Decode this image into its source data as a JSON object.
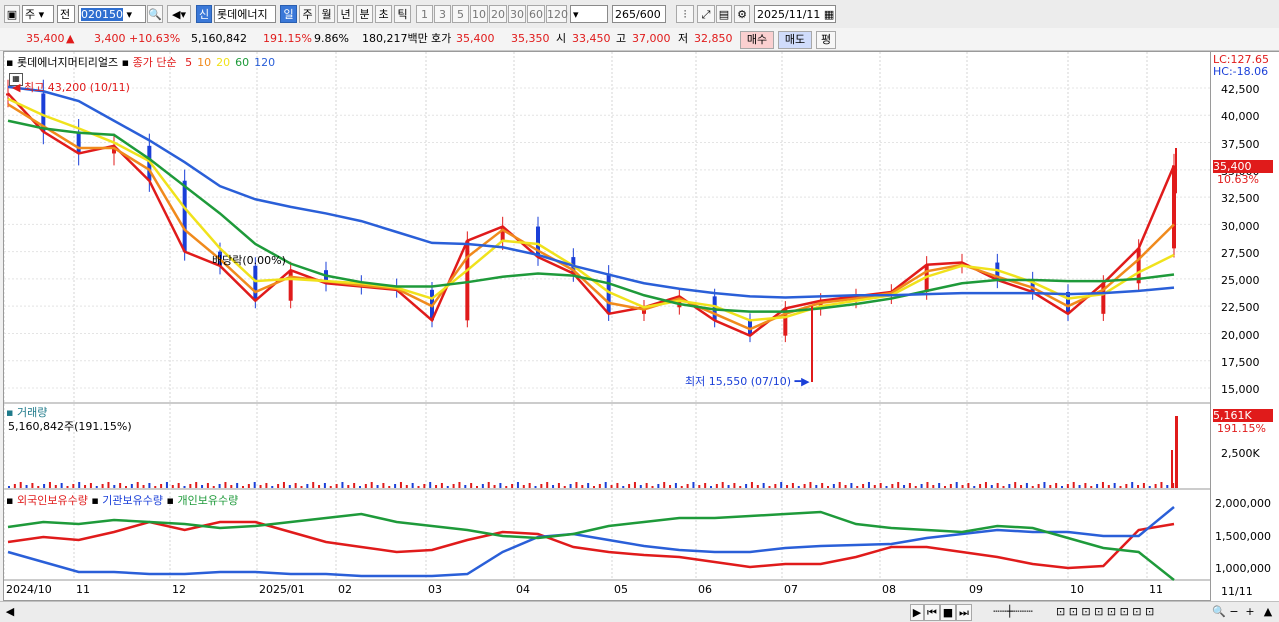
{
  "toolbar": {
    "mode1": "주",
    "mode2": "전",
    "code": "020150",
    "sin": "신",
    "stock_name": "롯데에너지",
    "periods": [
      "일",
      "주",
      "월",
      "년",
      "분",
      "초",
      "틱"
    ],
    "active_period": "일",
    "nums": [
      "1",
      "3",
      "5",
      "10",
      "20",
      "30",
      "60",
      "120"
    ],
    "count": "265",
    "count_total": "/600",
    "date": "2025/11/11"
  },
  "quote": {
    "price": "35,400",
    "change": "3,400",
    "change_pct": "+10.63%",
    "volume": "5,160,842",
    "vol_ratio": "191.15%",
    "turnover": "9.86%",
    "amount": "180,217백만",
    "bid_label": "호가",
    "ask": "35,400",
    "bid": "35,350",
    "open_label": "시",
    "open": "33,450",
    "high_label": "고",
    "high": "37,000",
    "low_label": "저",
    "low": "32,850",
    "buy_label": "매수",
    "sell_label": "매도",
    "avg_label": "평"
  },
  "price_panel": {
    "name": "롯데에너지머티리얼즈",
    "ma_label": "종가 단순",
    "ma_periods": [
      "5",
      "10",
      "20",
      "60",
      "120"
    ],
    "ma_colors": [
      "#e01b1b",
      "#f08a1c",
      "#f0e21c",
      "#1e9a3a",
      "#2a5fd8"
    ],
    "high_note": "최고 43,200 (10/11)",
    "low_note": "최저 15,550 (07/10)",
    "ex_note": "배당락(0.00%)",
    "lc": "LC:127.65",
    "hc": "HC:-18.06",
    "last_price": "35,400",
    "last_pct": "10.63%"
  },
  "volume_panel": {
    "title": "거래량",
    "value": "5,160,842주(191.15%)",
    "last": "5,161K",
    "last_pct": "191.15%"
  },
  "holding_panel": {
    "foreign": "외국인보유수량",
    "inst": "기관보유수량",
    "indiv": "개인보유수량"
  },
  "x_axis": [
    "2024/10",
    "11",
    "12",
    "2025/01",
    "02",
    "03",
    "04",
    "05",
    "06",
    "07",
    "08",
    "09",
    "10",
    "11"
  ],
  "x_axis_right": "11/11",
  "chart_data": {
    "type": "line",
    "price_y_ticks": [
      "42,500",
      "40,000",
      "37,500",
      "35,000",
      "32,500",
      "30,000",
      "27,500",
      "25,000",
      "22,500",
      "20,000",
      "17,500",
      "15,000"
    ],
    "volume_y_ticks": [
      "2,500K"
    ],
    "holding_y_ticks": [
      "2,000,000",
      "1,500,000",
      "1,000,000"
    ],
    "series": [
      {
        "name": "5",
        "color": "#e01b1b",
        "values": [
          42000,
          38500,
          36500,
          37200,
          34000,
          27500,
          26200,
          23000,
          25800,
          24600,
          24300,
          24000,
          21200,
          28500,
          29800,
          27000,
          25500,
          21800,
          22400,
          23400,
          21200,
          19800,
          22300,
          23000,
          23400,
          23800,
          26300,
          26500,
          24900,
          23800,
          21800,
          24600,
          27800,
          35400
        ]
      },
      {
        "name": "10",
        "color": "#f08a1c",
        "values": [
          41000,
          39000,
          37000,
          37000,
          35000,
          29500,
          26800,
          23800,
          25200,
          24800,
          24400,
          24100,
          22500,
          27000,
          29500,
          27600,
          25800,
          22800,
          22200,
          23200,
          21800,
          20400,
          21800,
          22800,
          23200,
          23700,
          25700,
          26300,
          25200,
          24200,
          22500,
          24000,
          26800,
          30000
        ]
      },
      {
        "name": "20",
        "color": "#f0e21c",
        "values": [
          41500,
          40000,
          38800,
          37500,
          35800,
          31500,
          27800,
          24800,
          25000,
          24800,
          24600,
          24200,
          23200,
          25800,
          28500,
          28200,
          26200,
          23800,
          22400,
          23000,
          22500,
          21200,
          21500,
          22500,
          23000,
          23500,
          25200,
          26200,
          25800,
          24700,
          23200,
          23600,
          25600,
          27200
        ]
      },
      {
        "name": "60",
        "color": "#1e9a3a",
        "values": [
          39500,
          38800,
          38400,
          38200,
          36000,
          33500,
          31000,
          28200,
          26400,
          25300,
          24700,
          24300,
          24300,
          24700,
          25200,
          25500,
          25300,
          24600,
          23500,
          22700,
          22200,
          22000,
          22000,
          22300,
          22700,
          23200,
          23900,
          24600,
          24900,
          24900,
          24800,
          24800,
          25000,
          25400
        ]
      },
      {
        "name": "120",
        "color": "#2a5fd8",
        "values": [
          42600,
          42200,
          41300,
          39500,
          37700,
          35700,
          33500,
          32300,
          31600,
          31000,
          30300,
          29300,
          28300,
          28200,
          27900,
          27200,
          26200,
          25400,
          24600,
          24100,
          23700,
          23400,
          23300,
          23400,
          23500,
          23500,
          23600,
          23700,
          23700,
          23700,
          23600,
          23700,
          23900,
          24200
        ]
      }
    ],
    "holdings": [
      {
        "name": "외국인보유수량",
        "color": "#e01b1b"
      },
      {
        "name": "기관보유수량",
        "color": "#2a5fd8"
      },
      {
        "name": "개인보유수량",
        "color": "#1e9a3a"
      }
    ]
  }
}
